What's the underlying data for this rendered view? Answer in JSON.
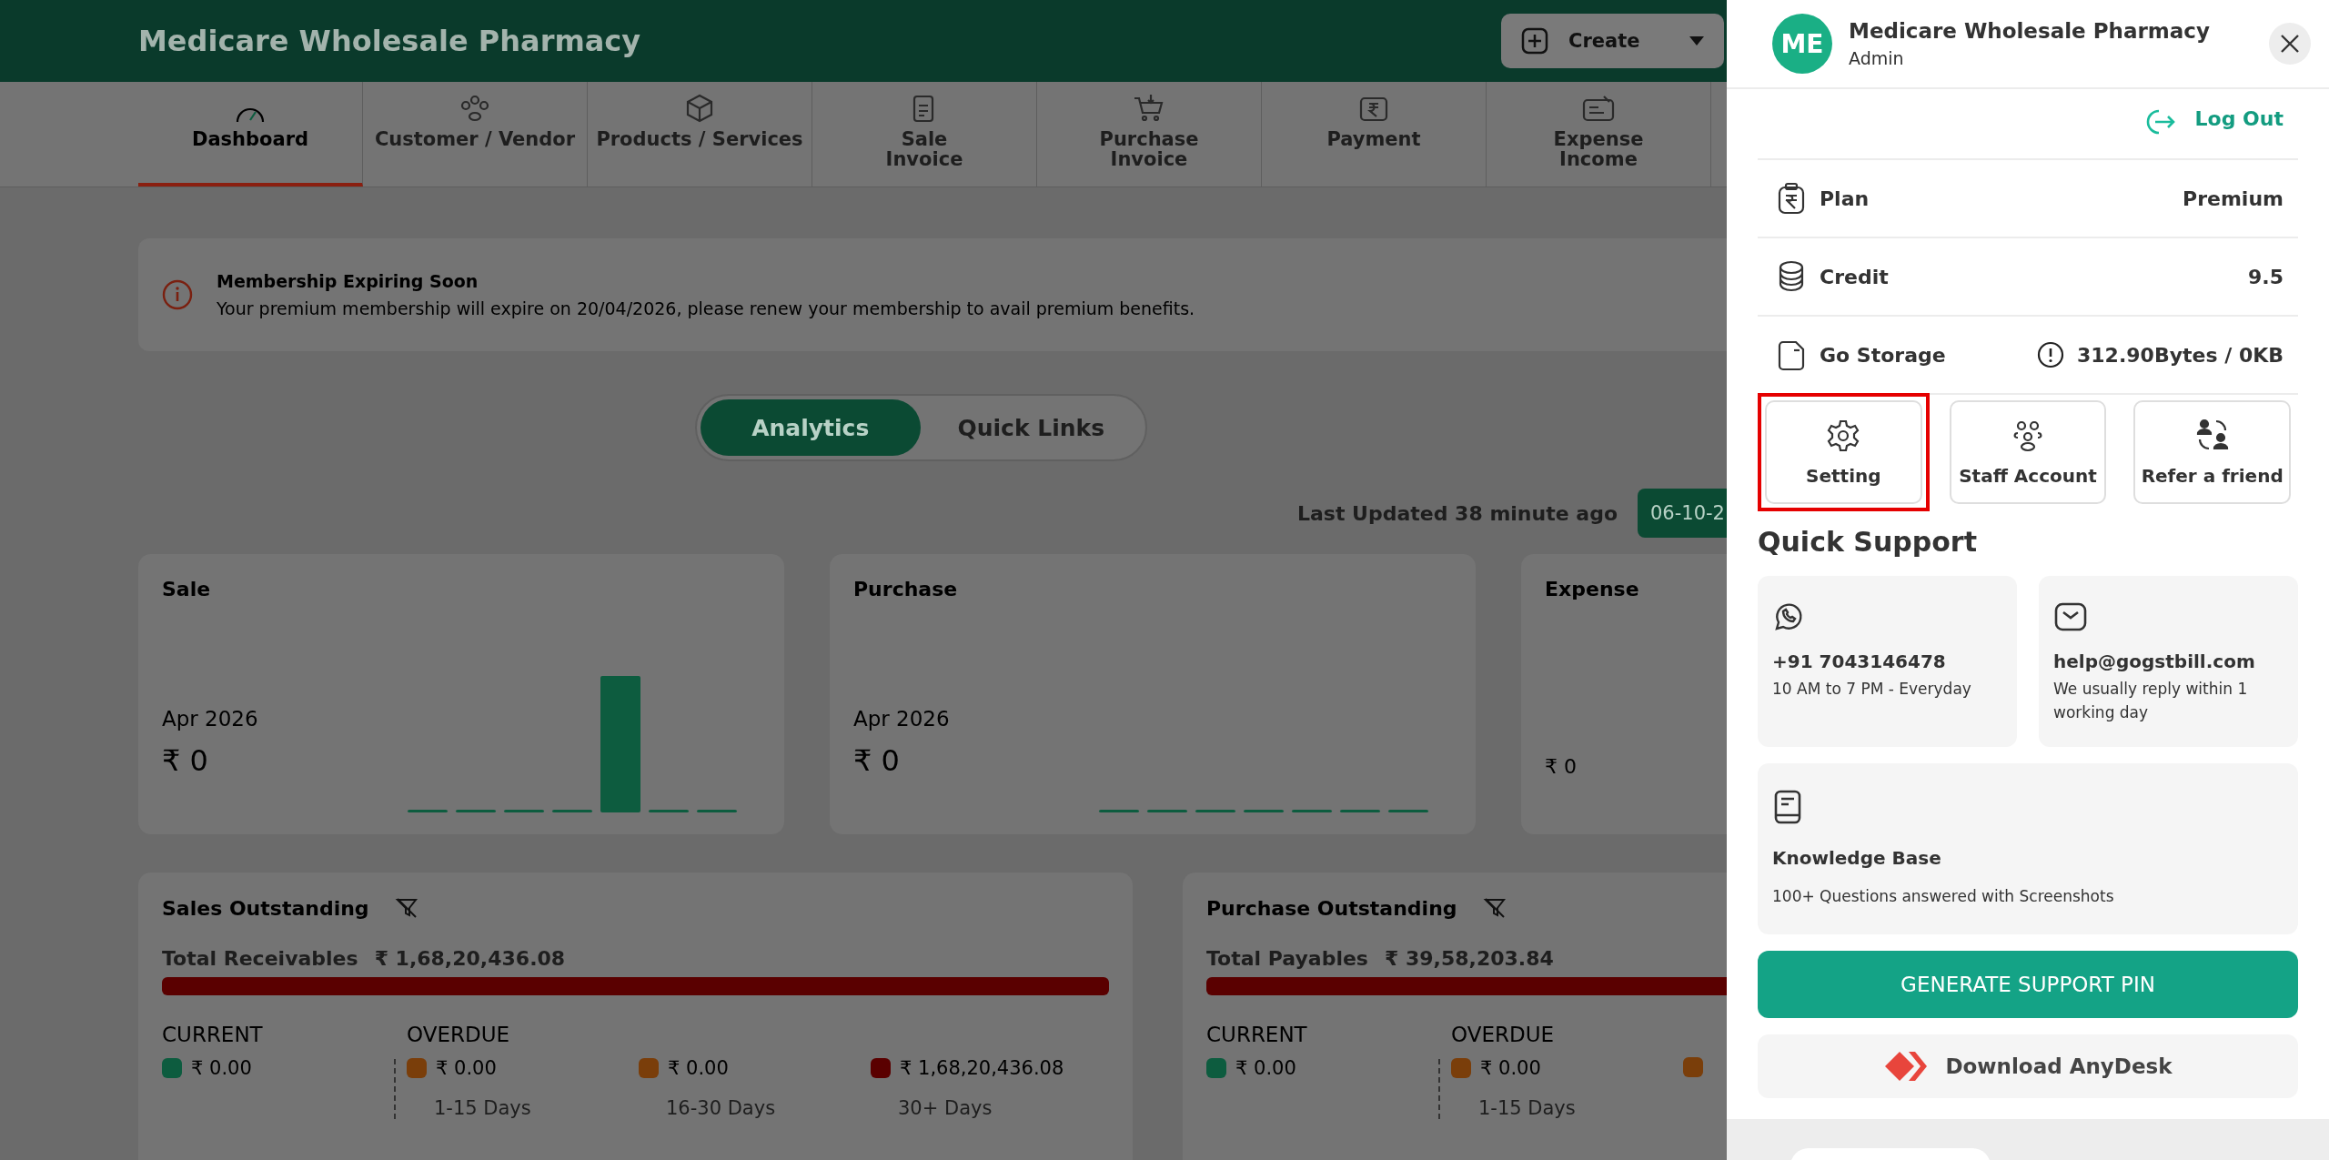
{
  "header": {
    "title": "Medicare Wholesale Pharmacy",
    "create_button": "Create"
  },
  "nav_tabs": [
    {
      "label": "Dashboard",
      "selected": true
    },
    {
      "label": "Customer / Vendor",
      "selected": false
    },
    {
      "label": "Products / Services",
      "selected": false
    },
    {
      "label": "Sale\nInvoice",
      "selected": false
    },
    {
      "label": "Purchase\nInvoice",
      "selected": false
    },
    {
      "label": "Payment",
      "selected": false
    },
    {
      "label": "Expense\nIncome",
      "selected": false
    }
  ],
  "banner": {
    "title": "Membership Expiring Soon",
    "message": "Your premium membership will expire on 20/04/2026, please renew your membership to avail premium benefits."
  },
  "view_toggle": [
    {
      "label": "Analytics",
      "selected": true
    },
    {
      "label": "Quick Links",
      "selected": false
    }
  ],
  "last_updated": "Last Updated 38 minute ago",
  "date_button": "06-10-2",
  "summary_cards": [
    {
      "title": "Sale",
      "period": "Apr 2026",
      "amount": "₹ 0"
    },
    {
      "title": "Purchase",
      "period": "Apr 2026",
      "amount": "₹ 0"
    },
    {
      "title": "Expense",
      "amount": "₹ 0"
    }
  ],
  "outstanding": [
    {
      "title": "Sales Outstanding",
      "total_label": "Total Receivables",
      "total": "₹ 1,68,20,436.08",
      "current_heading": "CURRENT",
      "overdue_heading": "OVERDUE",
      "current": {
        "amount": "₹ 0.00",
        "color": "#0d5c3f"
      },
      "overdue": [
        {
          "amount": "₹ 0.00",
          "period": "1-15 Days",
          "color": "#7a3e0a"
        },
        {
          "amount": "₹ 0.00",
          "period": "16-30 Days",
          "color": "#7a3e0a"
        },
        {
          "amount": "₹ 1,68,20,436.08",
          "period": "30+ Days",
          "color": "#5a0000"
        }
      ]
    },
    {
      "title": "Purchase Outstanding",
      "total_label": "Total Payables",
      "total": "₹ 39,58,203.84",
      "current_heading": "CURRENT",
      "overdue_heading": "OVERDUE",
      "current": {
        "amount": "₹ 0.00",
        "color": "#0d5c3f"
      },
      "overdue": [
        {
          "amount": "₹ 0.00",
          "period": "1-15 Days",
          "color": "#7a3e0a"
        },
        {
          "color": "#7a3e0a"
        }
      ]
    }
  ],
  "drawer": {
    "profile": {
      "initials": "ME",
      "name": "Medicare Wholesale Pharmacy",
      "role": "Admin"
    },
    "logout": "Log Out",
    "info_rows": [
      {
        "label": "Plan",
        "value": "Premium"
      },
      {
        "label": "Credit",
        "value": "9.5"
      },
      {
        "label": "Go Storage",
        "value": "312.90Bytes / 0KB"
      }
    ],
    "actions": [
      {
        "label": "Setting",
        "highlighted": true
      },
      {
        "label": "Staff Account",
        "highlighted": false
      },
      {
        "label": "Refer a friend",
        "highlighted": false
      }
    ],
    "quick_support": {
      "heading": "Quick Support",
      "contacts": [
        {
          "title": "+91 7043146478",
          "subtitle": "10 AM to 7 PM - Everyday"
        },
        {
          "title": "help@gogstbill.com",
          "subtitle": "We usually reply within 1 working day"
        }
      ],
      "knowledge": {
        "title": "Knowledge Base",
        "subtitle": "100+ Questions answered with Screenshots"
      }
    },
    "support_pin_button": "GENERATE SUPPORT PIN",
    "anydesk_button": "Download AnyDesk"
  }
}
